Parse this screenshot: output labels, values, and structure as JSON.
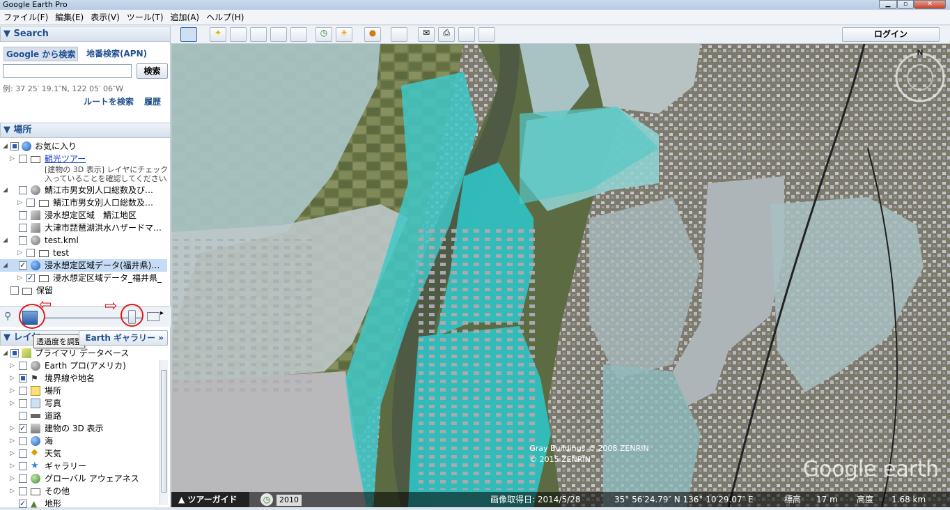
{
  "window": {
    "title": "Google Earth Pro"
  },
  "menu": [
    "ファイル(F)",
    "編集(E)",
    "表示(V)",
    "ツール(T)",
    "追加(A)",
    "ヘルプ(H)"
  ],
  "search": {
    "header": "▼ Search",
    "tab_google": "Google から検索",
    "tab_apn": "地番検索(APN)",
    "input_value": "",
    "button": "検索",
    "example": "例: 37 25′ 19.1″N, 122 05′ 06″W",
    "route_link": "ルートを検索",
    "history_link": "履歴"
  },
  "places": {
    "header": "▼ 場所",
    "items": [
      {
        "label": "お気に入り"
      },
      {
        "label": "観光ツアー"
      },
      {
        "label": "[建物の 3D 表示] レイヤにチェックが"
      },
      {
        "label": "入っていることを確認してください。"
      },
      {
        "label": "鯖江市男女別人口総数及び…"
      },
      {
        "label": "鯖江市男女別人口総数及…"
      },
      {
        "label": "浸水想定区域　鯖江地区"
      },
      {
        "label": "大津市琵琶湖洪水ハザードマ…"
      },
      {
        "label": "test.kml"
      },
      {
        "label": "test"
      },
      {
        "label": "浸水想定区域データ(福井県)…"
      },
      {
        "label": "浸水想定区域データ_福井県_"
      },
      {
        "label": "保留"
      }
    ]
  },
  "tooltip": "透過度を調整",
  "layers": {
    "header": "▼ レイヤ",
    "gallery_button": "Earth ギャラリー »",
    "items": [
      {
        "label": "プライマリ データベース"
      },
      {
        "label": "Earth プロ(アメリカ)"
      },
      {
        "label": "境界線や地名"
      },
      {
        "label": "場所"
      },
      {
        "label": "写真"
      },
      {
        "label": "道路"
      },
      {
        "label": "建物の 3D 表示"
      },
      {
        "label": "海"
      },
      {
        "label": "天気"
      },
      {
        "label": "ギャラリー"
      },
      {
        "label": "グローバル アウェアネス"
      },
      {
        "label": "その他"
      },
      {
        "label": "地形"
      }
    ]
  },
  "toolbar": {
    "login": "ログイン"
  },
  "map": {
    "copyright1": "Gray Buildings © 2008 ZENRIN",
    "copyright2": "© 2015 ZENRIN",
    "watermark": "Google earth",
    "compass_n": "N"
  },
  "statusbar": {
    "tour_guide": "ツアーガイド",
    "year": "2010",
    "imagery_date": "画像取得日: 2014/5/28",
    "coords": "35° 56′24.79″ N 136° 10′29.07″ E",
    "elev_label": "標高",
    "elev": "17 m",
    "alt_label": "高度",
    "alt": "1.68 km"
  },
  "colors": {
    "accent": "#1f4f8f",
    "flood": "#3fc8c8",
    "annotation": "#e01818"
  }
}
